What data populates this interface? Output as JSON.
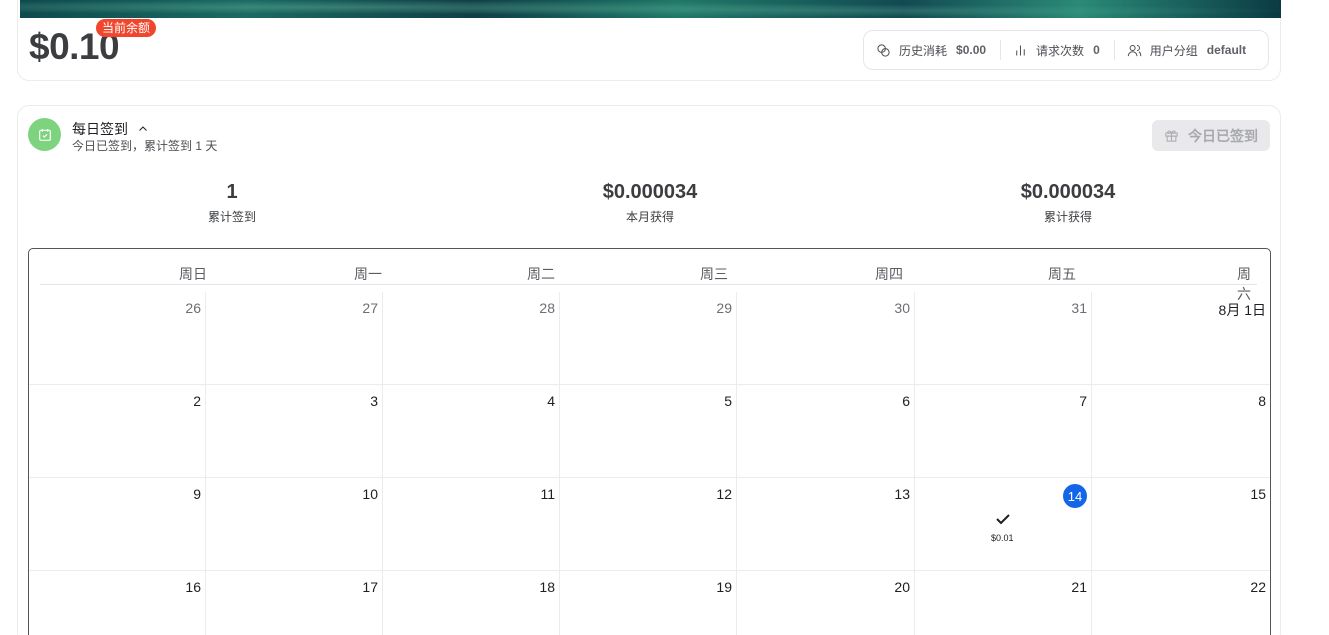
{
  "balance": {
    "amount": "$0.10",
    "badge": "当前余额",
    "stats": [
      {
        "icon": "coins-icon",
        "label": "历史消耗",
        "value": "$0.00"
      },
      {
        "icon": "bar-chart-icon",
        "label": "请求次数",
        "value": "0"
      },
      {
        "icon": "users-icon",
        "label": "用户分组",
        "value": "default"
      }
    ]
  },
  "checkin": {
    "title": "每日签到",
    "subtitle": "今日已签到，累计签到 1 天",
    "button_label": "今日已签到",
    "summary": [
      {
        "value": "1",
        "label": "累计签到"
      },
      {
        "value": "$0.000034",
        "label": "本月获得"
      },
      {
        "value": "$0.000034",
        "label": "累计获得"
      }
    ]
  },
  "calendar": {
    "weekdays": [
      "周日",
      "周一",
      "周二",
      "周三",
      "周四",
      "周五",
      "周六"
    ],
    "weeks": [
      [
        "26",
        "27",
        "28",
        "29",
        "30",
        "31",
        "8月 1日"
      ],
      [
        "2",
        "3",
        "4",
        "5",
        "6",
        "7",
        "8"
      ],
      [
        "9",
        "10",
        "11",
        "12",
        "13",
        "14",
        "15"
      ],
      [
        "16",
        "17",
        "18",
        "19",
        "20",
        "21",
        "22"
      ]
    ],
    "today": "14",
    "checked_reward": "$0.01",
    "accent": "#1466e8"
  }
}
